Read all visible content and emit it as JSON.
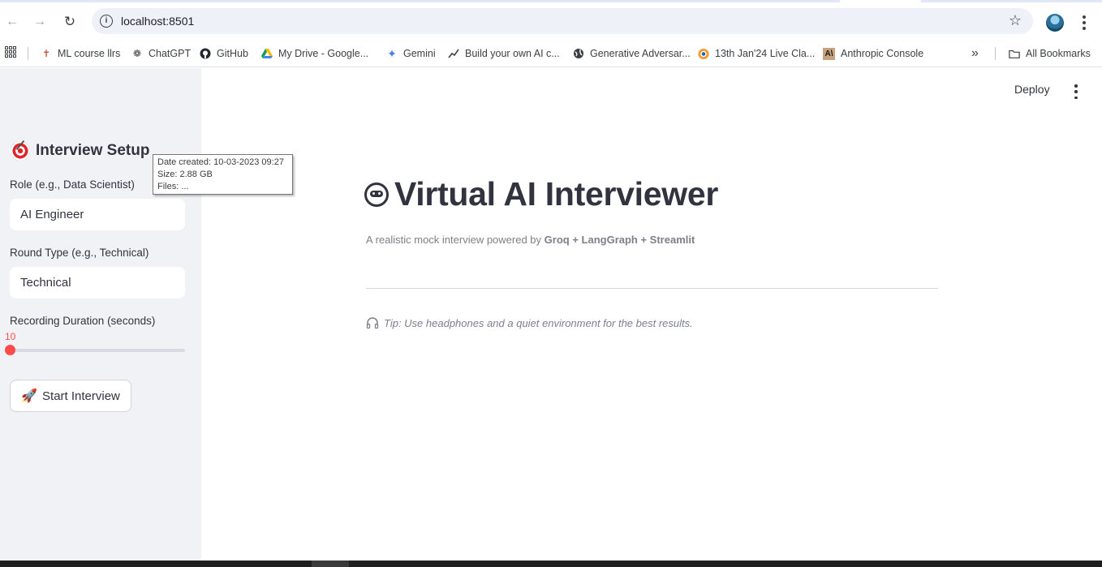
{
  "browser": {
    "url": "localhost:8501",
    "bookmarks": [
      {
        "label": "ML course llrs",
        "icon": "pin-icon"
      },
      {
        "label": "ChatGPT",
        "icon": "openai-icon"
      },
      {
        "label": "GitHub",
        "icon": "github-icon"
      },
      {
        "label": "My Drive - Google...",
        "icon": "drive-icon"
      },
      {
        "label": "Gemini",
        "icon": "gemini-icon"
      },
      {
        "label": "Build your own AI c...",
        "icon": "trend-icon"
      },
      {
        "label": "Generative Adversar...",
        "icon": "globe-icon"
      },
      {
        "label": "13th Jan'24 Live Cla...",
        "icon": "live-icon"
      },
      {
        "label": "Anthropic Console",
        "icon": "anthropic-icon"
      }
    ],
    "all_bookmarks": "All Bookmarks",
    "overflow": "»"
  },
  "sidebar": {
    "title": "Interview Setup",
    "role_label": "Role (e.g., Data Scientist)",
    "role_value": "AI Engineer",
    "round_label": "Round Type (e.g., Technical)",
    "round_value": "Technical",
    "duration_label": "Recording Duration (seconds)",
    "duration_value": "10",
    "duration_fraction": 0.0,
    "start_button": "Start Interview"
  },
  "tooltip": {
    "line1": "Date created: 10-03-2023 09:27",
    "line2": "Size: 2.88 GB",
    "line3": "Files: ..."
  },
  "header": {
    "deploy": "Deploy"
  },
  "main": {
    "title": "Virtual AI Interviewer",
    "subtitle_prefix": "A realistic mock interview powered by ",
    "subtitle_bold": "Groq + LangGraph + Streamlit",
    "tip": "Tip: Use headphones and a quiet environment for the best results."
  },
  "colors": {
    "accent": "#ff4b4b",
    "sidebar_bg": "#f0f2f6",
    "text": "#31333f",
    "muted": "#7d8089"
  }
}
